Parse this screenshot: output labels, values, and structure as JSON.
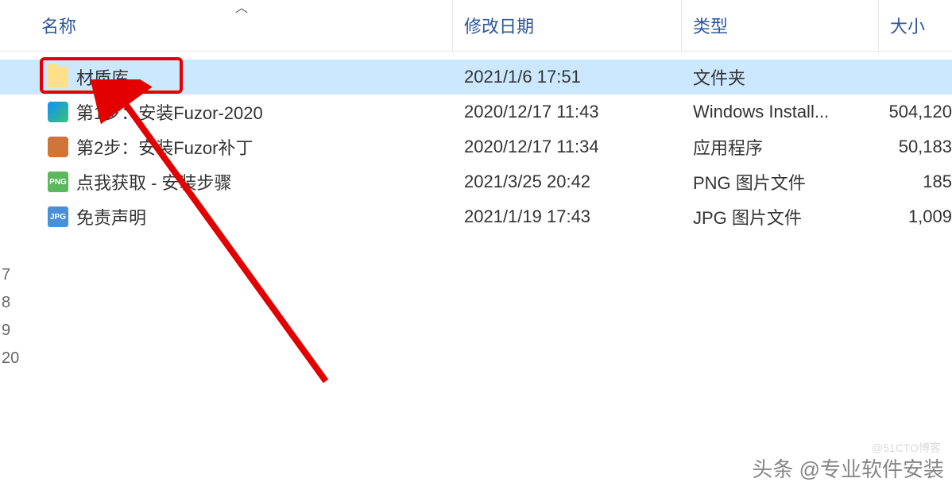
{
  "columns": {
    "name": "名称",
    "date": "修改日期",
    "type": "类型",
    "size": "大小"
  },
  "rows": [
    {
      "icon": "folder",
      "name": "材质库",
      "date": "2021/1/6 17:51",
      "type": "文件夹",
      "size": "",
      "selected": true
    },
    {
      "icon": "msi",
      "name": "第1步：安装Fuzor-2020",
      "date": "2020/12/17 11:43",
      "type": "Windows Install...",
      "size": "504,120"
    },
    {
      "icon": "app",
      "name": "第2步：安装Fuzor补丁",
      "date": "2020/12/17 11:34",
      "type": "应用程序",
      "size": "50,183"
    },
    {
      "icon": "png",
      "name": "点我获取 - 安装步骤",
      "date": "2021/3/25 20:42",
      "type": "PNG 图片文件",
      "size": "185"
    },
    {
      "icon": "jpg",
      "name": "免责声明",
      "date": "2021/1/19 17:43",
      "type": "JPG 图片文件",
      "size": "1,009"
    }
  ],
  "iconText": {
    "png": "PNG",
    "jpg": "JPG"
  },
  "leftChars": [
    "7",
    "8",
    "9",
    "20"
  ],
  "watermark": "头条 @专业软件安装",
  "watermark2": "@51CTO博客"
}
